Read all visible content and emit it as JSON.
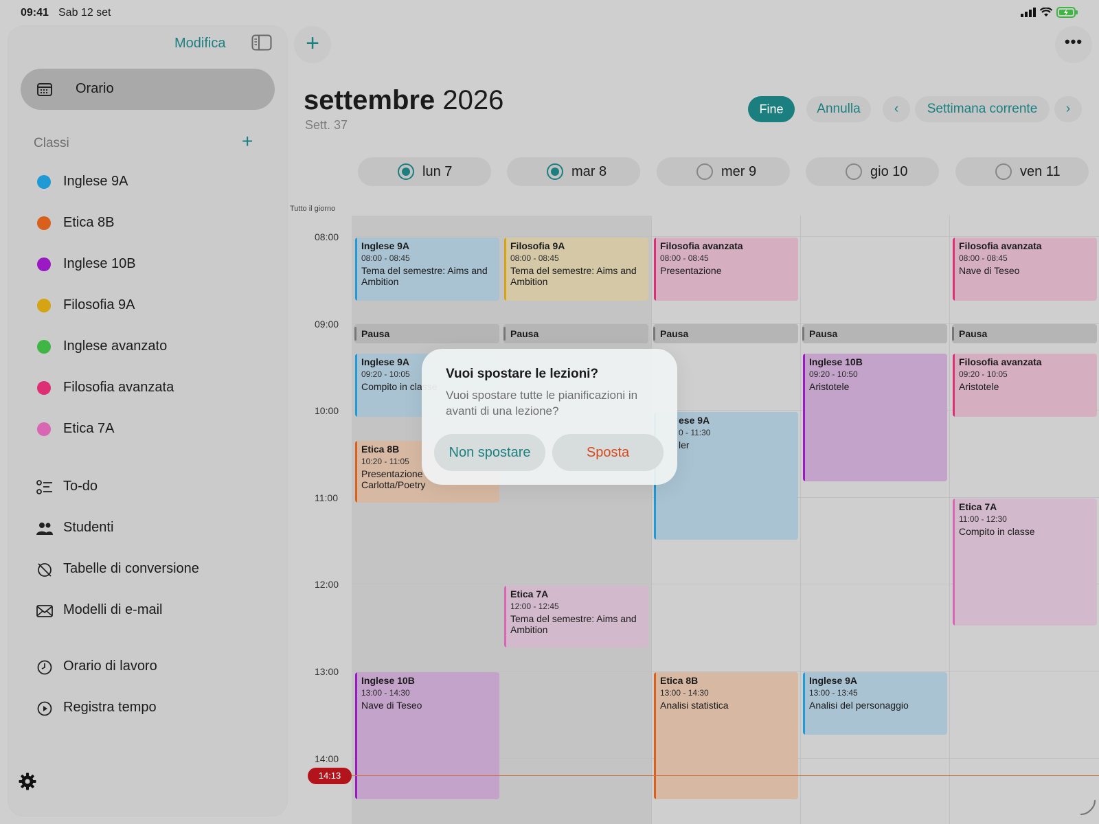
{
  "status_bar": {
    "time": "09:41",
    "date": "Sab 12 set"
  },
  "sidebar": {
    "edit_label": "Modifica",
    "selected": {
      "label": "Orario",
      "icon": "calendar-icon"
    },
    "section_title": "Classi",
    "classes": [
      {
        "label": "Inglese 9A",
        "color": "#1e9ad6"
      },
      {
        "label": "Etica 8B",
        "color": "#d9601a"
      },
      {
        "label": "Inglese 10B",
        "color": "#9b19c2"
      },
      {
        "label": "Filosofia 9A",
        "color": "#d6a314"
      },
      {
        "label": "Inglese avanzato",
        "color": "#3fb544"
      },
      {
        "label": "Filosofia avanzata",
        "color": "#dd2f73"
      },
      {
        "label": "Etica 7A",
        "color": "#d767b3"
      }
    ],
    "tools": [
      {
        "label": "To-do",
        "icon": "checklist-icon"
      },
      {
        "label": "Studenti",
        "icon": "people-icon"
      },
      {
        "label": "Tabelle di conversione",
        "icon": "conversion-icon"
      },
      {
        "label": "Modelli di e-mail",
        "icon": "envelope-icon"
      }
    ],
    "work": [
      {
        "label": "Orario di lavoro",
        "icon": "clock-icon"
      },
      {
        "label": "Registra tempo",
        "icon": "play-circle-icon"
      }
    ]
  },
  "header": {
    "month_bold": "settembre",
    "year": "2026",
    "week": "Sett. 37",
    "done_label": "Fine",
    "cancel_label": "Annulla",
    "current_week_label": "Settimana corrente"
  },
  "days": [
    {
      "label": "lun 7",
      "selected": true
    },
    {
      "label": "mar 8",
      "selected": true
    },
    {
      "label": "mer 9",
      "selected": false
    },
    {
      "label": "gio 10",
      "selected": false
    },
    {
      "label": "ven 11",
      "selected": false
    }
  ],
  "all_day_label": "Tutto il giorno",
  "hours": [
    "08:00",
    "09:00",
    "10:00",
    "11:00",
    "12:00",
    "13:00",
    "14:00"
  ],
  "now_label": "14:13",
  "pause_label": "Pausa",
  "events": {
    "mon_1": {
      "title": "Inglese 9A",
      "time": "08:00 - 08:45",
      "note": "Tema del semestre: Aims and Ambition",
      "color": "#a9c3d2",
      "bar": "#1e9ad6"
    },
    "mon_2": {
      "title": "Inglese 9A",
      "time": "09:20 - 10:05",
      "note": "Compito in classe",
      "color": "#a9c3d2",
      "bar": "#1e9ad6"
    },
    "mon_3": {
      "title": "Etica 8B",
      "time": "10:20 - 11:05",
      "note": "Presentazione Carlotta/Poetry",
      "color": "#d7b9a3",
      "bar": "#d9601a"
    },
    "mon_4": {
      "title": "Inglese 10B",
      "time": "13:00 - 14:30",
      "note": "Nave di Teseo",
      "color": "#c3a3c9",
      "bar": "#9b19c2"
    },
    "tue_1": {
      "title": "Filosofia 9A",
      "time": "08:00 - 08:45",
      "note": "Tema del semestre: Aims and Ambition",
      "color": "#d4c8a7",
      "bar": "#d6a314"
    },
    "tue_2": {
      "title": "Etica 7A",
      "time": "12:00 - 12:45",
      "note": "Tema del semestre: Aims and Ambition",
      "color": "#d2b9cc",
      "bar": "#d767b3"
    },
    "wed_1": {
      "title": "Filosofia avanzata",
      "time": "08:00 - 08:45",
      "note": "Presentazione",
      "color": "#d5aec0",
      "bar": "#dd2f73"
    },
    "wed_2": {
      "title": "ese 9A",
      "time": "0 - 11:30",
      "note": "ler",
      "color": "#a9c3d2",
      "bar": "#1e9ad6"
    },
    "wed_3": {
      "title": "Etica 8B",
      "time": "13:00 - 14:30",
      "note": "Analisi statistica",
      "color": "#d7b9a3",
      "bar": "#d9601a"
    },
    "thu_1": {
      "title": "Inglese 10B",
      "time": "09:20 - 10:50",
      "note": "Aristotele",
      "color": "#c3a3c9",
      "bar": "#9b19c2"
    },
    "thu_2": {
      "title": "Inglese 9A",
      "time": "13:00 - 13:45",
      "note": "Analisi del personaggio",
      "color": "#a9c3d2",
      "bar": "#1e9ad6"
    },
    "fri_1": {
      "title": "Filosofia avanzata",
      "time": "08:00 - 08:45",
      "note": "Nave di Teseo",
      "color": "#d5aec0",
      "bar": "#dd2f73"
    },
    "fri_2": {
      "title": "Filosofia avanzata",
      "time": "09:20 - 10:05",
      "note": "Aristotele",
      "color": "#d5aec0",
      "bar": "#dd2f73"
    },
    "fri_3": {
      "title": "Etica 7A",
      "time": "11:00 - 12:30",
      "note": "Compito in classe",
      "color": "#d2b9cc",
      "bar": "#d767b3"
    }
  },
  "dialog": {
    "title": "Vuoi spostare le lezioni?",
    "message": "Vuoi spostare tutte le pianificazioni in avanti di una lezione?",
    "secondary_label": "Non spostare",
    "primary_label": "Sposta",
    "secondary_color": "#1b7f80",
    "primary_color": "#d64a1f"
  },
  "accent_color": "#1b7f80"
}
